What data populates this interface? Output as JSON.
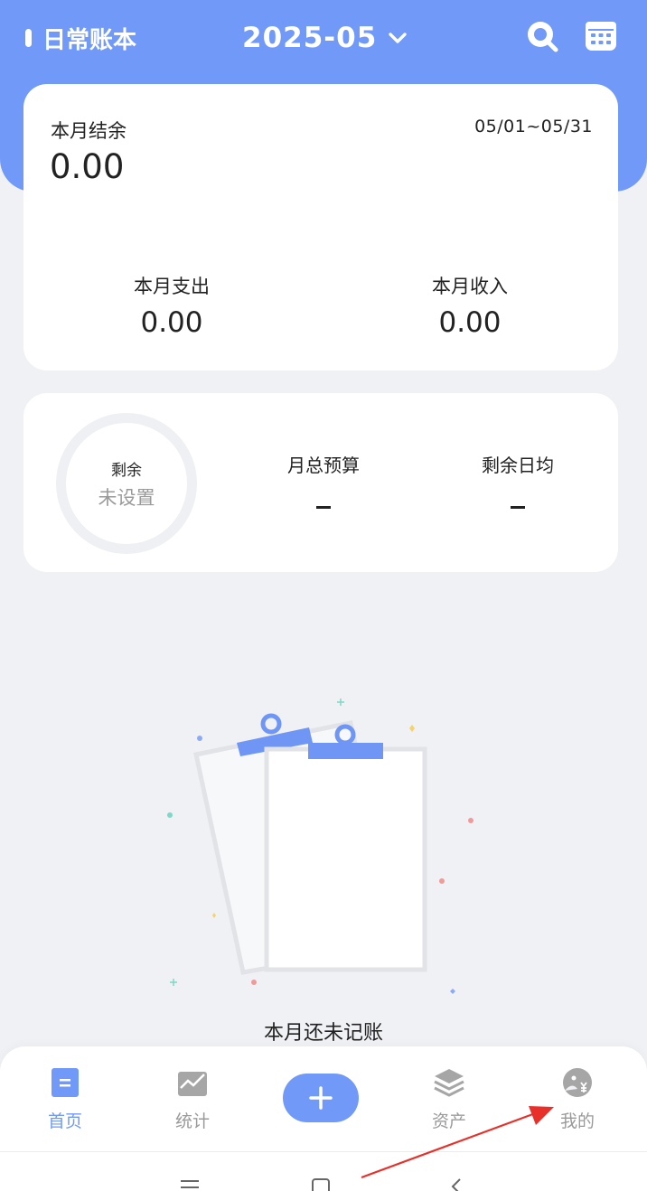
{
  "header": {
    "app_title": "日常账本",
    "month": "2025-05",
    "icons": [
      "search-icon",
      "calendar-icon",
      "chevron-down-icon"
    ]
  },
  "summary": {
    "balance_label": "本月结余",
    "balance_value": "0.00",
    "date_range": "05/01~05/31",
    "expense_label": "本月支出",
    "expense_value": "0.00",
    "income_label": "本月收入",
    "income_value": "0.00"
  },
  "budget": {
    "remaining_label": "剩余",
    "remaining_value": "未设置",
    "total_label": "月总预算",
    "total_value": "-",
    "daily_label": "剩余日均",
    "daily_value": "-"
  },
  "empty_state": {
    "message": "本月还未记账"
  },
  "tabbar": {
    "tabs": [
      {
        "label": "首页",
        "icon": "home-doc-icon",
        "active": true
      },
      {
        "label": "统计",
        "icon": "chart-icon",
        "active": false
      },
      {
        "label": "资产",
        "icon": "layers-icon",
        "active": false
      },
      {
        "label": "我的",
        "icon": "profile-icon",
        "active": false
      }
    ],
    "add_icon": "plus-icon"
  },
  "colors": {
    "accent": "#7199f8",
    "background": "#f0f1f5",
    "annotation_arrow": "#e8302a"
  }
}
